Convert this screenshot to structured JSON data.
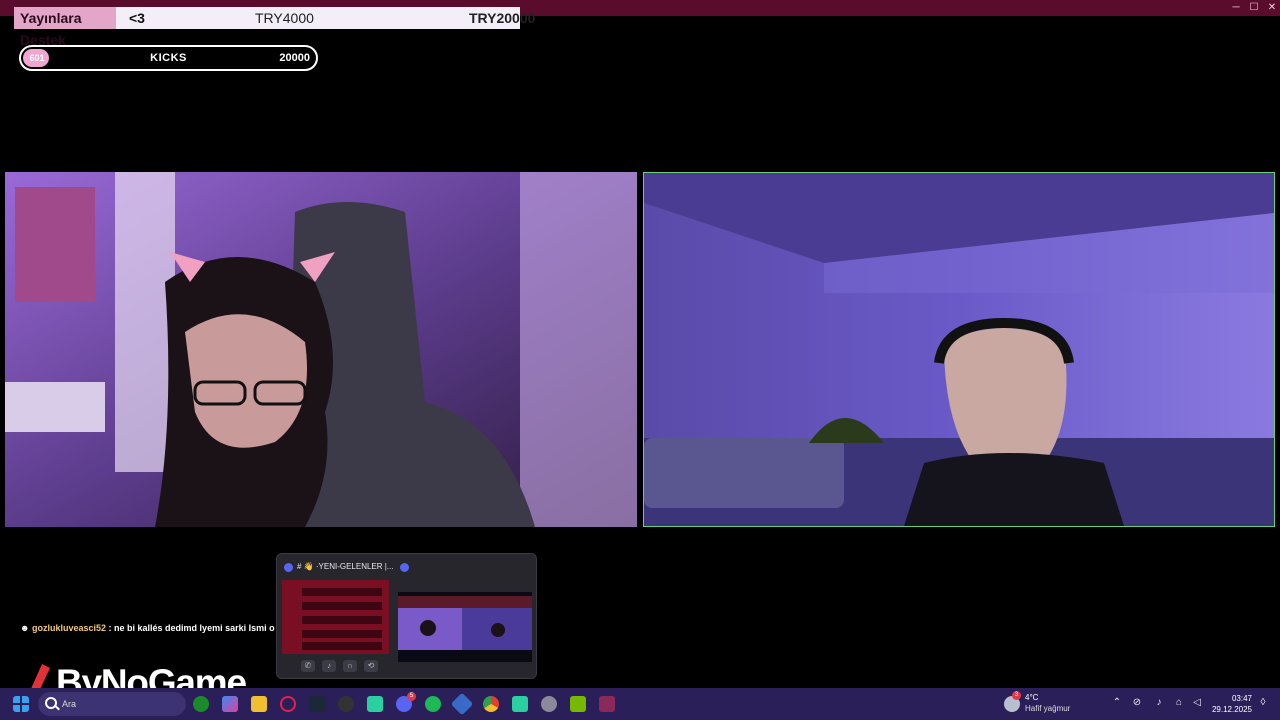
{
  "window": {
    "minimize_glyph": "─",
    "maximize_glyph": "☐",
    "close_glyph": "✕"
  },
  "donation": {
    "label": "Yayınlara Destek",
    "heart": "<3",
    "current": "TRY4000",
    "goal": "TRY20000"
  },
  "kicks": {
    "count": "601",
    "label": "KICKS",
    "goal": "20000",
    "progress_fraction": 0.03
  },
  "chat": {
    "user": "gozlukluveasci52",
    "separator": " : ",
    "message": "ne bi kallés dedimd lyemi sarki Ismi o"
  },
  "logo": {
    "text": "ByNoGame"
  },
  "preview": {
    "title": "# 👋 ·YENI-GELENLER |..."
  },
  "taskbar": {
    "search_placeholder": "Ara",
    "discord_badge": "5",
    "weather_badge": "3",
    "weather_temp": "4°C",
    "weather_desc": "Hafif yağmur",
    "time": "03:47",
    "date": "29.12.2025"
  },
  "colors": {
    "accent": "#e3a6c8",
    "titlebar": "#5a0c2c",
    "taskbar": "#2b1f5a",
    "cam_border": "#6ad078"
  }
}
